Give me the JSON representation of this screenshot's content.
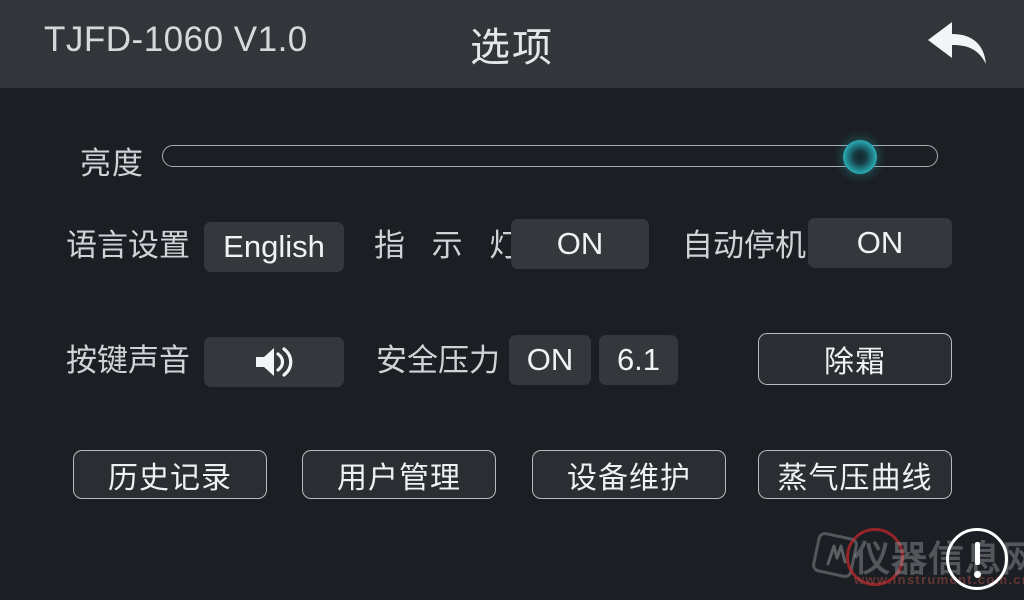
{
  "header": {
    "model": "TJFD-1060 V1.0",
    "title": "选项",
    "back_icon": "back-arrow-icon"
  },
  "brightness": {
    "label": "亮度",
    "value_percent": 89,
    "knob_color": "#2cacb4",
    "track_color": "#a9adb2"
  },
  "rows": [
    {
      "language": {
        "label": "语言设置",
        "value": "English"
      },
      "indicator": {
        "label": "指 示 灯",
        "value": "ON"
      },
      "auto_stop": {
        "label": "自动停机",
        "value": "ON"
      }
    },
    {
      "key_sound": {
        "label": "按键声音",
        "icon": "speaker-on-icon"
      },
      "safety_pressure": {
        "label": "安全压力",
        "state": "ON",
        "value": "6.1"
      },
      "defrost": {
        "label": "除霜"
      }
    }
  ],
  "actions": [
    {
      "label": "历史记录"
    },
    {
      "label": "用户管理"
    },
    {
      "label": "设备维护"
    },
    {
      "label": "蒸气压曲线"
    }
  ],
  "watermark": {
    "text": "仪器信息网",
    "url": "www.instrument.com.cn"
  },
  "alert": {
    "icon": "exclamation-circle-icon"
  },
  "colors": {
    "header_bg": "#32363b",
    "body_bg": "#1b1e22",
    "button_fill": "#34383d",
    "outline_fill": "#2a2e33",
    "outline_border": "#b7bbbf",
    "text": "#eef0f2",
    "label_text": "#cfd3d7",
    "accent": "#2cacb4"
  }
}
